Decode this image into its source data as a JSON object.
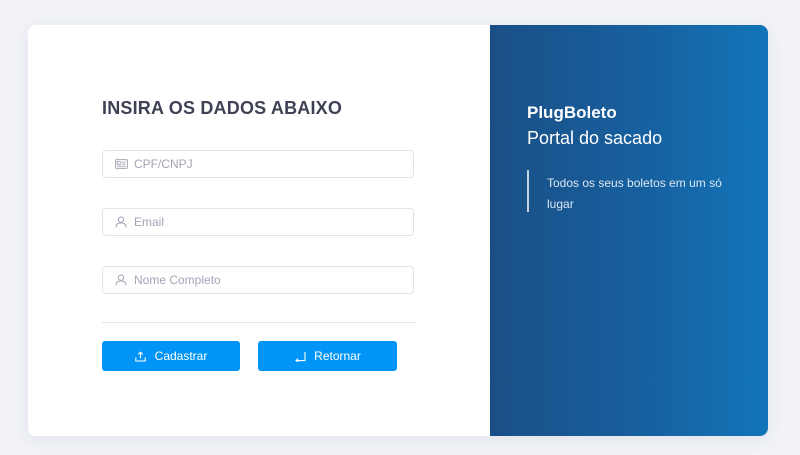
{
  "form": {
    "title": "INSIRA OS DADOS ABAIXO",
    "fields": [
      {
        "icon": "id-card-icon",
        "placeholder": "CPF/CNPJ",
        "value": ""
      },
      {
        "icon": "user-icon",
        "placeholder": "Email",
        "value": ""
      },
      {
        "icon": "user-icon",
        "placeholder": "Nome Completo",
        "value": ""
      }
    ],
    "buttons": {
      "register_label": "Cadastrar",
      "register_icon": "upload-icon",
      "back_label": "Retornar",
      "back_icon": "return-arrow-icon"
    }
  },
  "brand": {
    "name": "PlugBoleto",
    "subtitle": "Portal do sacado",
    "tagline": "Todos os seus boletos em um só lugar"
  },
  "colors": {
    "background": "#f1f3f7",
    "title_text": "#3f4254",
    "placeholder_text": "#a2a5b5",
    "field_border": "#e0e3ea",
    "button": "#0095f6",
    "panel_gradient_start": "#1a4f86",
    "panel_gradient_end": "#1275b9"
  }
}
